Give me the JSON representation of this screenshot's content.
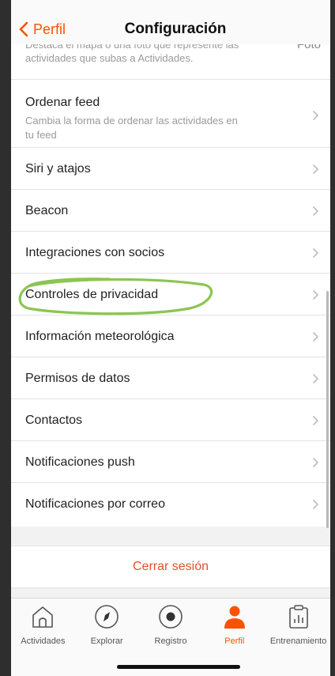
{
  "header": {
    "back_label": "Perfil",
    "title": "Configuración"
  },
  "partial_item": {
    "description": "Destaca el mapa o una foto que represente las actividades que subas a Actividades.",
    "value": "Foto"
  },
  "settings": {
    "items": [
      {
        "label": "Ordenar feed",
        "subtitle": "Cambia la forma de ordenar las actividades en tu feed"
      },
      {
        "label": "Siri y atajos"
      },
      {
        "label": "Beacon"
      },
      {
        "label": "Integraciones con socios"
      },
      {
        "label": "Controles de privacidad"
      },
      {
        "label": "Información meteorológica"
      },
      {
        "label": "Permisos de datos"
      },
      {
        "label": "Contactos"
      },
      {
        "label": "Notificaciones push"
      },
      {
        "label": "Notificaciones por correo"
      }
    ]
  },
  "logout_label": "Cerrar sesión",
  "tabbar": {
    "tabs": [
      {
        "label": "Actividades",
        "icon": "home-icon"
      },
      {
        "label": "Explorar",
        "icon": "compass-icon"
      },
      {
        "label": "Registro",
        "icon": "record-icon"
      },
      {
        "label": "Perfil",
        "icon": "person-icon",
        "active": true
      },
      {
        "label": "Entrenamiento",
        "icon": "clipboard-chart-icon"
      }
    ]
  },
  "colors": {
    "accent": "#fc5200",
    "logout": "#e2502d",
    "highlight_circle": "#7fbf3f"
  }
}
